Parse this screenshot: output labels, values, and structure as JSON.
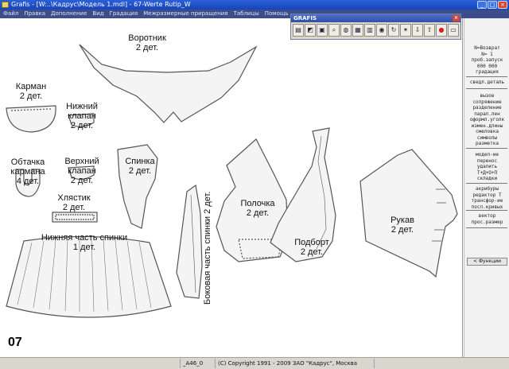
{
  "window": {
    "title": "Grafis - [W:..\\Кадрус\\Модель 1.mdl] - 67-Werte Rutip_W"
  },
  "menu": [
    "Файл",
    "Правка",
    "Дополнение",
    "Вид",
    "Градация",
    "Межразмерные приращения",
    "Таблицы",
    "Помощь"
  ],
  "toolbar": {
    "title": "GRAFIS",
    "buttons": [
      "open-icon",
      "layers-icon",
      "save-icon",
      "find-icon",
      "zoom-icon",
      "table-icon",
      "grid-icon",
      "globe-icon",
      "rotate-icon",
      "star-icon",
      "insert-icon",
      "export-icon",
      "stop-icon",
      "screen-icon"
    ]
  },
  "pieces": [
    {
      "name": "Воротник",
      "count": "2 дет."
    },
    {
      "name": "Карман",
      "count": "2 дет."
    },
    {
      "name": "Нижний\nклапан",
      "count": "2 дет."
    },
    {
      "name": "Обтачка\nкармана",
      "count": "4 дет."
    },
    {
      "name": "Верхний\nклапан",
      "count": "2 дет."
    },
    {
      "name": "Спинка",
      "count": "2 дет."
    },
    {
      "name": "Хлястик",
      "count": "2 дет."
    },
    {
      "name": "Нижняя часть спинки",
      "count": "1 дет."
    },
    {
      "name": "Боковая часть спинки",
      "count": "2 дет."
    },
    {
      "name": "Полочка",
      "count": "2 дет."
    },
    {
      "name": "Подборт",
      "count": "2 дет."
    },
    {
      "name": "Рукав",
      "count": "2 дет."
    }
  ],
  "page_number": "07",
  "right_panel": {
    "group1": [
      "N=Возврат",
      "N=  1",
      "проб.запуск",
      "000 000",
      "градация"
    ],
    "group2": [
      "сведл.деталь"
    ],
    "group3": [
      "вызов",
      "сопряжение",
      "разделение",
      "парал.лен",
      "оформл.уголк",
      "измен.длины",
      "смеловка",
      "символы",
      "разметка"
    ],
    "group4": [
      "модел-ие",
      "перенос",
      "удалить",
      "Т+Д+О+П",
      "складки"
    ],
    "group5": [
      "акрибуры",
      "редактор Т",
      "трансфор-ие",
      "посл.кривых"
    ],
    "group6": [
      "вектор",
      "прос.размер"
    ],
    "button": "< Функции"
  },
  "status": {
    "cell1": "",
    "cell2": "_A46_0",
    "cell3": "(C) Copyright 1991 - 2009 ЗАО \"Кадрус\", Москва",
    "cell4": ""
  }
}
